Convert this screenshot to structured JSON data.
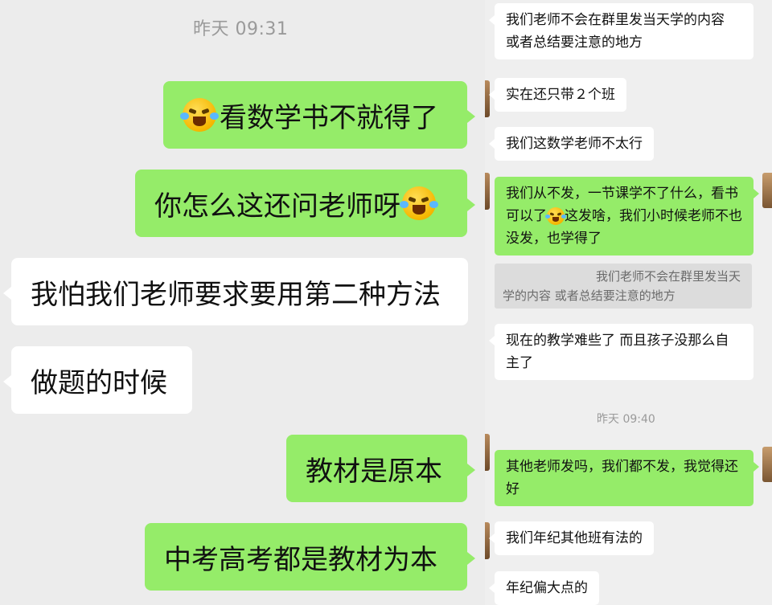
{
  "left_panel": {
    "timestamp": "昨天 09:31",
    "messages": [
      {
        "side": "right",
        "text": "看数学书不就得了",
        "emoji_position": "before",
        "emoji": "laughing-crying-face"
      },
      {
        "side": "right",
        "text": "你怎么这还问老师呀",
        "emoji_position": "after",
        "emoji": "laughing-crying-face"
      },
      {
        "side": "left",
        "text": "我怕我们老师要求要用第二种方法"
      },
      {
        "side": "left",
        "text": "做题的时候"
      },
      {
        "side": "right",
        "text": "教材是原本"
      },
      {
        "side": "right",
        "text": "中考高考都是教材为本"
      }
    ]
  },
  "right_panel": {
    "timestamp": "昨天 09:40",
    "messages": [
      {
        "side": "left",
        "text": "我们老师不会在群里发当天学的内容  或者总结要注意的地方"
      },
      {
        "side": "left",
        "text": "实在还只带２个班"
      },
      {
        "side": "left",
        "text": "我们这数学老师不太行"
      },
      {
        "side": "right",
        "text_before": "我们从不发，一节课学不了什么，看书可以了",
        "text_after": "这发啥，我们小时候老师不也没发，也学得了",
        "emoji": "laughing-crying-face"
      },
      {
        "side": "left",
        "text": "现在的教学难些了 而且孩子没那么自主了"
      },
      {
        "side": "right",
        "text": "其他老师发吗，我们都不发，我觉得还好"
      },
      {
        "side": "left",
        "text": "我们年纪其他班有法的"
      },
      {
        "side": "left",
        "text": "年纪偏大点的"
      }
    ],
    "quote": {
      "line1": "我们老师不会在群里发当天",
      "line2": "学的内容  或者总结要注意的地方"
    }
  },
  "colors": {
    "sent_bubble": "#95ec69",
    "received_bubble": "#ffffff",
    "background": "#ededed",
    "timestamp": "#9a9a9a"
  }
}
